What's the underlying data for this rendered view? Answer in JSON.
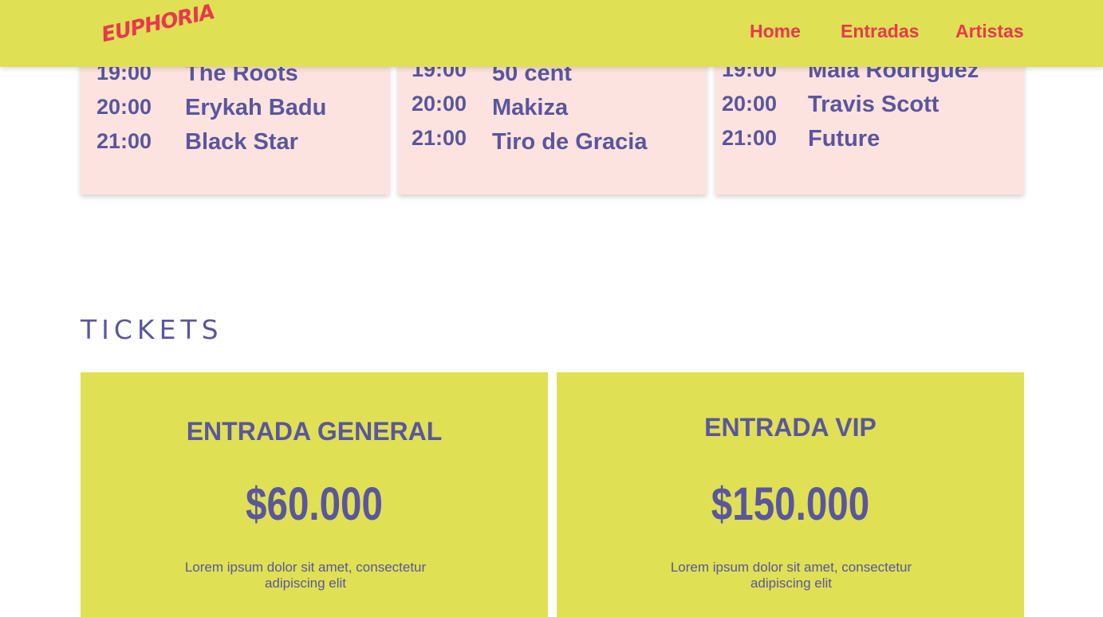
{
  "nav": {
    "logo": "EUPHORIA",
    "links": [
      "Home",
      "Entradas",
      "Artistas"
    ]
  },
  "schedule": [
    {
      "rows": [
        {
          "time": "19:00",
          "artist": "The Roots"
        },
        {
          "time": "20:00",
          "artist": "Erykah Badu"
        },
        {
          "time": "21:00",
          "artist": "Black Star"
        }
      ]
    },
    {
      "rows": [
        {
          "time": "19:00",
          "artist": "50 cent"
        },
        {
          "time": "20:00",
          "artist": "Makiza"
        },
        {
          "time": "21:00",
          "artist": "Tiro de Gracia"
        }
      ]
    },
    {
      "rows": [
        {
          "time": "19:00",
          "artist": "Mala Rodriguez"
        },
        {
          "time": "20:00",
          "artist": "Travis Scott"
        },
        {
          "time": "21:00",
          "artist": "Future"
        }
      ]
    }
  ],
  "tickets": {
    "title": "TICKETS",
    "cards": [
      {
        "name": "ENTRADA GENERAL",
        "price": "$60.000",
        "desc": "Lorem ipsum dolor sit amet, consectetur adipiscing elit"
      },
      {
        "name": "ENTRADA VIP",
        "price": "$150.000",
        "desc": "Lorem ipsum dolor sit amet, consectetur adipiscing elit"
      }
    ]
  },
  "colors": {
    "accent_yellow": "#dfe054",
    "accent_red": "#e8384f",
    "text_purple": "#5a569d",
    "card_pink": "#fde3df"
  }
}
